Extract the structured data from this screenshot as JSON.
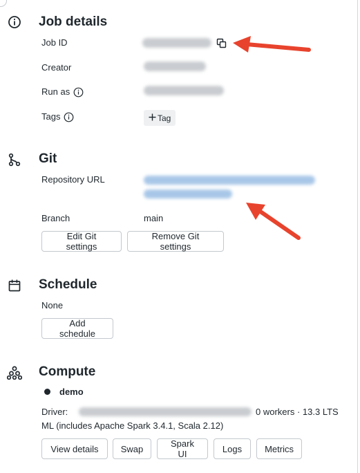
{
  "job_details": {
    "title": "Job details",
    "job_id_label": "Job ID",
    "creator_label": "Creator",
    "run_as_label": "Run as",
    "tags_label": "Tags",
    "add_tag_label": "Tag"
  },
  "git": {
    "title": "Git",
    "repository_url_label": "Repository URL",
    "branch_label": "Branch",
    "branch_value": "main",
    "edit_button": "Edit Git settings",
    "remove_button": "Remove Git settings"
  },
  "schedule": {
    "title": "Schedule",
    "value": "None",
    "add_button": "Add schedule"
  },
  "compute": {
    "title": "Compute",
    "cluster_name": "demo",
    "driver_label": "Driver:",
    "workers_text": "0 workers · 13.3 LTS",
    "runtime_text": "ML (includes Apache Spark 3.4.1, Scala 2.12)",
    "buttons": [
      "View details",
      "Swap",
      "Spark UI",
      "Logs",
      "Metrics"
    ]
  },
  "colors": {
    "text": "#1f272d",
    "annotation_arrow": "#e8432d",
    "blur_gray": "#c9ccd0",
    "blur_blue": "#a8c7e8"
  }
}
